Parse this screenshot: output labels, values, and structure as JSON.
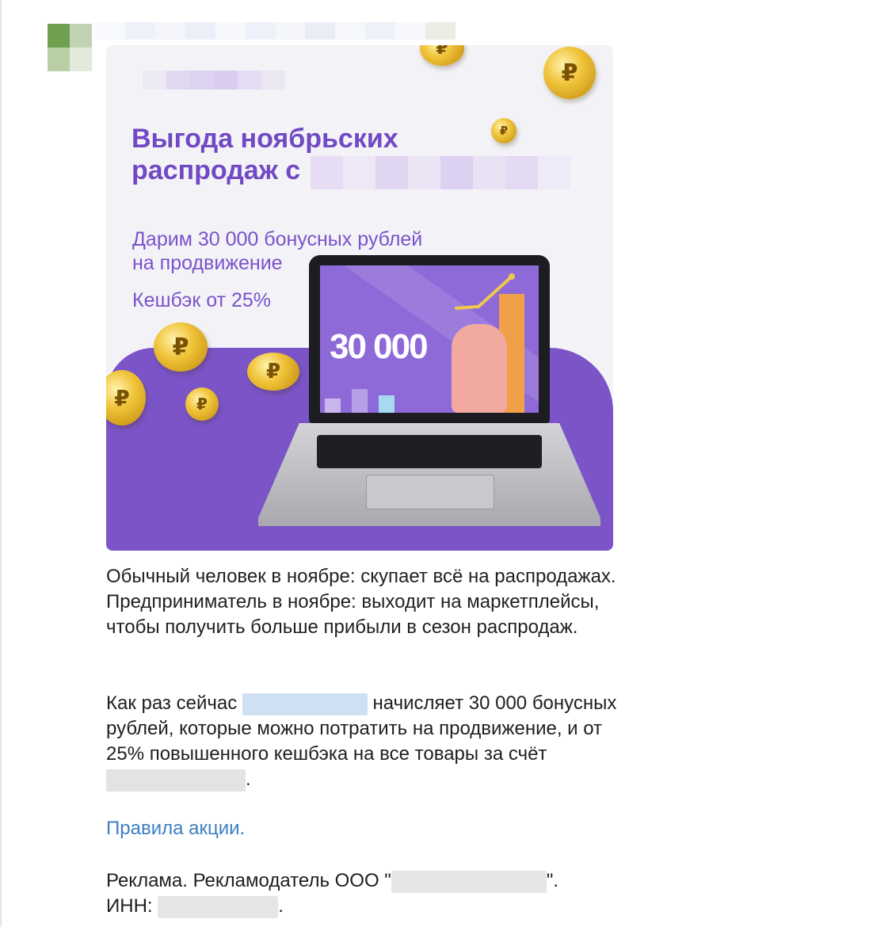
{
  "banner": {
    "headline_line1": "Выгода ноябрьских",
    "headline_line2_prefix": "распродаж с ",
    "offer_line1": "Дарим  30 000 бонусных рублей",
    "offer_line2": "на продвижение",
    "cashback": "Кешбэк от 25%",
    "screen_number": "30 000",
    "currency_symbol": "₽"
  },
  "post": {
    "paragraph1": "Обычный человек в ноябре: скупает всё на распродажах. Предприниматель в ноябре: выходит на маркетплейсы, чтобы получить больше прибыли в сезон распродаж.",
    "paragraph2_part1": "Как раз сейчас ",
    "paragraph2_part2": " начисляет 30 000 бонусных рублей, которые можно потратить на продвижение, и от 25% повышенного кешбэка на все товары за счёт ",
    "paragraph2_end": ".",
    "rules_link": "Правила акции.",
    "ad_prefix": "Реклама. Рекламодатель ООО \"",
    "ad_suffix": "\".",
    "inn_prefix": "ИНН: ",
    "inn_suffix": "."
  },
  "colors": {
    "accent_purple": "#7249c4",
    "link_blue": "#3d7fc2",
    "coin_gold": "#f0c43a"
  }
}
